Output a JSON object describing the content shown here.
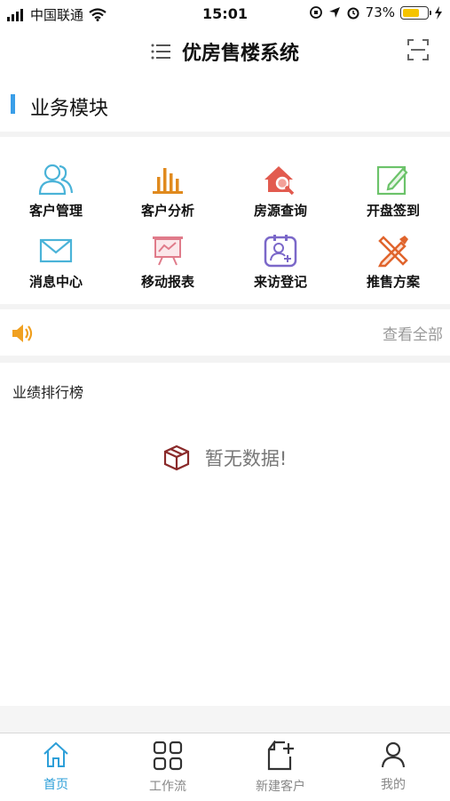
{
  "status_bar": {
    "carrier": "中国联通",
    "time": "15:01",
    "battery": "73%",
    "battery_level": 0.73
  },
  "navbar": {
    "title": "优房售楼系统"
  },
  "section": {
    "title": "业务模块"
  },
  "modules": [
    {
      "label": "客户管理",
      "icon": "customers-icon",
      "color": "#4ab3d8"
    },
    {
      "label": "客户分析",
      "icon": "bar-chart-icon",
      "color": "#e08a1e"
    },
    {
      "label": "房源查询",
      "icon": "house-search-icon",
      "color": "#e25b4f"
    },
    {
      "label": "开盘签到",
      "icon": "edit-checkin-icon",
      "color": "#6cc36a"
    },
    {
      "label": "消息中心",
      "icon": "mail-icon",
      "color": "#4ab3d8"
    },
    {
      "label": "移动报表",
      "icon": "report-board-icon",
      "color": "#e07b8a"
    },
    {
      "label": "来访登记",
      "icon": "visitor-register-icon",
      "color": "#7b68c9"
    },
    {
      "label": "推售方案",
      "icon": "tools-icon",
      "color": "#e0642c"
    }
  ],
  "notice": {
    "view_all": "查看全部",
    "icon": "speaker-icon",
    "color": "#f0a020"
  },
  "ranking": {
    "title": "业绩排行榜",
    "empty_text": "暂无数据!",
    "empty_icon": "package-box-icon"
  },
  "tabs": [
    {
      "label": "首页",
      "icon": "home-icon",
      "active": true
    },
    {
      "label": "工作流",
      "icon": "grid-icon",
      "active": false
    },
    {
      "label": "新建客户",
      "icon": "new-document-icon",
      "active": false
    },
    {
      "label": "我的",
      "icon": "user-icon",
      "active": false
    }
  ],
  "accent_color": "#2d9fd8"
}
